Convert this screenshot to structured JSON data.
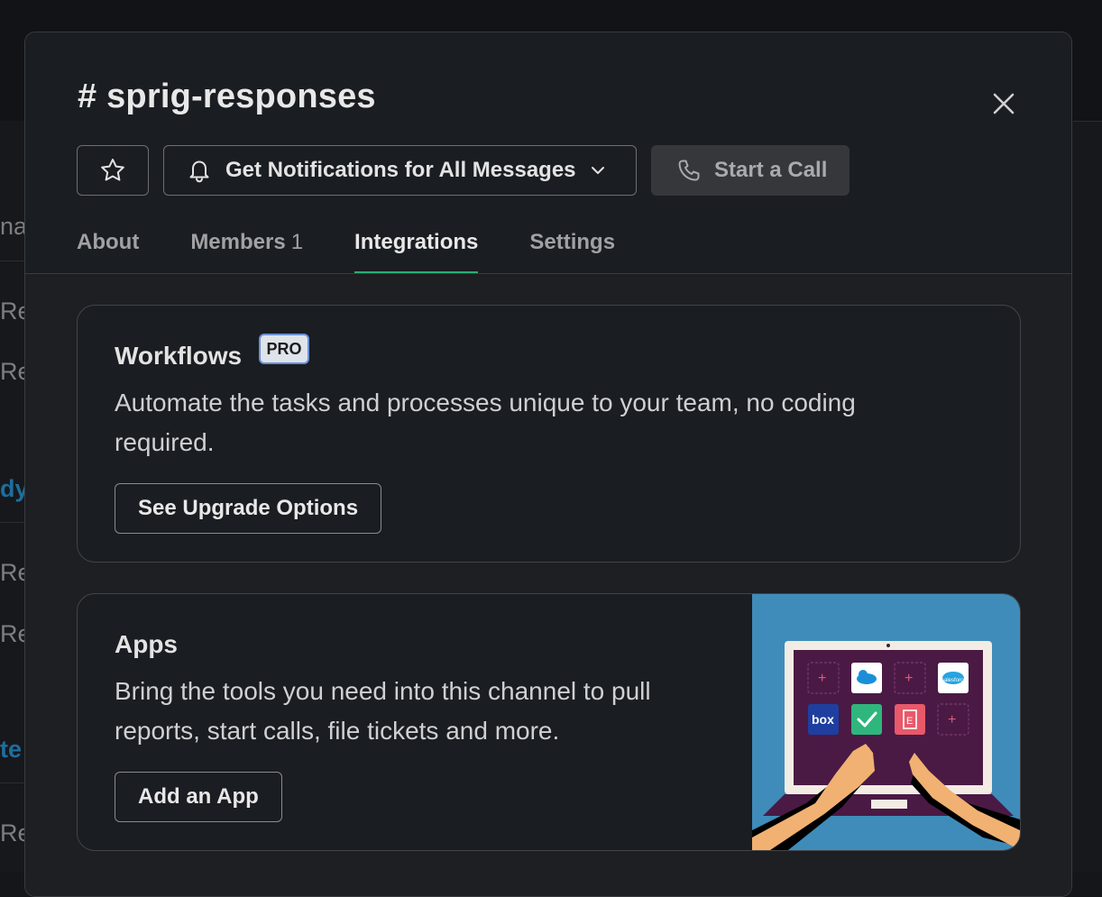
{
  "channel": {
    "title": "# sprig-responses"
  },
  "header_actions": {
    "notifications_label": "Get Notifications for All Messages",
    "call_label": "Start a Call"
  },
  "tabs": [
    {
      "label": "About",
      "count": ""
    },
    {
      "label": "Members",
      "count": "1"
    },
    {
      "label": "Integrations",
      "count": ""
    },
    {
      "label": "Settings",
      "count": ""
    }
  ],
  "active_tab": "Integrations",
  "workflows": {
    "title": "Workflows",
    "badge": "PRO",
    "description_line1": "Automate the tasks and processes unique to your team, no coding",
    "description_line2": "required.",
    "button_label": "See Upgrade Options"
  },
  "apps": {
    "title": "Apps",
    "description_line1": "Bring the tools you need into this channel to pull",
    "description_line2": "reports, start calls, file tickets and more.",
    "button_label": "Add an App",
    "illustration_tiles": [
      "box",
      "salesforce"
    ]
  },
  "background_fragments": [
    "nas",
    "Re",
    "Re",
    "dy",
    "Re",
    "Re",
    "te",
    "Re"
  ],
  "colors": {
    "modal_bg": "#1a1d21",
    "tab_underline": "#2bac76",
    "badge_border": "#6b8fd6",
    "illustration_bg": "#3f8cba"
  },
  "icons": {
    "star": "star-icon",
    "bell": "bell-icon",
    "chevron": "chevron-down-icon",
    "phone": "phone-icon",
    "close": "close-icon"
  }
}
